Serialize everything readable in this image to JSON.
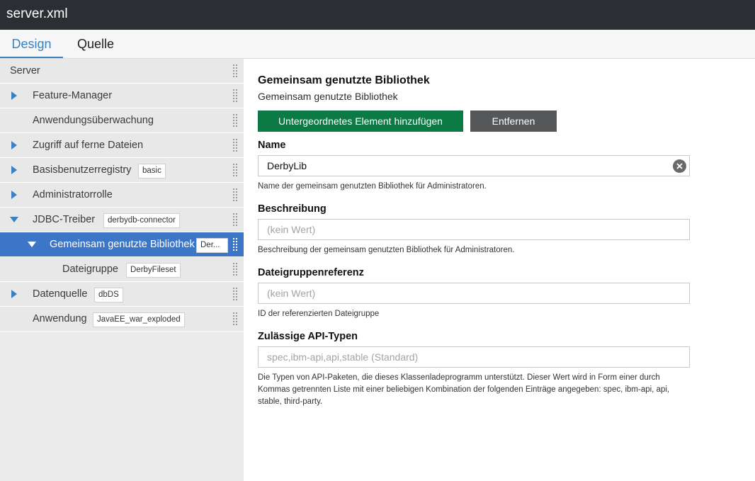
{
  "window": {
    "title": "server.xml"
  },
  "tabs": [
    {
      "label": "Design",
      "active": true
    },
    {
      "label": "Quelle",
      "active": false
    }
  ],
  "sidebar": {
    "root_label": "Server",
    "items": [
      {
        "label": "Feature-Manager",
        "expander": "collapsed"
      },
      {
        "label": "Anwendungsüberwachung",
        "expander": "none"
      },
      {
        "label": "Zugriff auf ferne Dateien",
        "expander": "collapsed"
      },
      {
        "label": "Basisbenutzerregistry",
        "badge": "basic",
        "expander": "collapsed"
      },
      {
        "label": "Administratorrolle",
        "expander": "collapsed"
      },
      {
        "label": "JDBC-Treiber",
        "badge": "derbydb-connector",
        "expander": "expanded"
      },
      {
        "label": "Gemeinsam genutzte Bibliothek",
        "badge": "Der...",
        "expander": "expanded",
        "selected": true
      },
      {
        "label": "Dateigruppe",
        "badge": "DerbyFileset",
        "expander": "none"
      },
      {
        "label": "Datenquelle",
        "badge": "dbDS",
        "expander": "collapsed"
      },
      {
        "label": "Anwendung",
        "badge": "JavaEE_war_exploded",
        "expander": "none"
      }
    ]
  },
  "panel": {
    "title": "Gemeinsam genutzte Bibliothek",
    "subtitle": "Gemeinsam genutzte Bibliothek",
    "add_button": "Untergeordnetes Element hinzufügen",
    "remove_button": "Entfernen",
    "fields": {
      "name": {
        "label": "Name",
        "value": "DerbyLib",
        "help": "Name der gemeinsam genutzten Bibliothek für Administratoren."
      },
      "description": {
        "label": "Beschreibung",
        "placeholder": "(kein Wert)",
        "help": "Beschreibung der gemeinsam genutzten Bibliothek für Administratoren."
      },
      "fileset_ref": {
        "label": "Dateigruppenreferenz",
        "placeholder": "(kein Wert)",
        "help": "ID der referenzierten Dateigruppe"
      },
      "api_types": {
        "label": "Zulässige API-Typen",
        "placeholder": "spec,ibm-api,api,stable (Standard)",
        "help": "Die Typen von API-Paketen, die dieses Klassenladeprogramm unterstützt. Dieser Wert wird in Form einer durch Kommas getrennten Liste mit einer beliebigen Kombination der folgenden Einträge angegeben: spec, ibm-api, api, stable, third-party."
      }
    }
  },
  "colors": {
    "titlebar": "#2b2f33",
    "accent_blue": "#3c80c4",
    "selected_row": "#3e76c7",
    "add_button": "#0b7a44",
    "remove_button": "#555759"
  },
  "icons": {
    "expander_collapsed": "triangle-right-icon",
    "expander_expanded": "triangle-down-icon",
    "drag_handle": "grip-dots-icon",
    "clear": "clear-circle-icon"
  }
}
